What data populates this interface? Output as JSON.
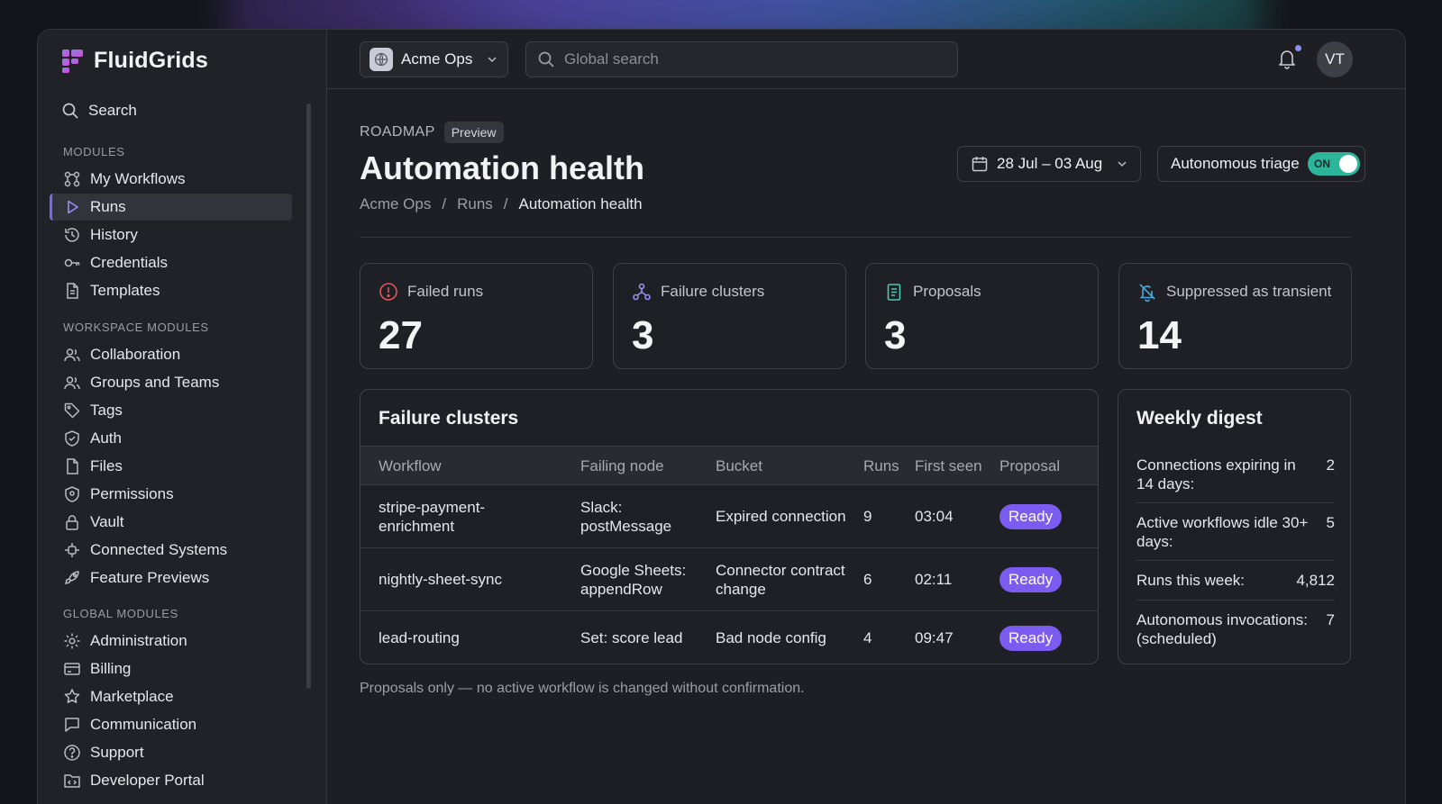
{
  "brand": {
    "name": "FluidGrids"
  },
  "sidebar": {
    "search_label": "Search",
    "sections": {
      "modules": "MODULES",
      "workspace": "WORKSPACE MODULES",
      "global": "GLOBAL MODULES"
    },
    "modules": [
      {
        "label": "My Workflows",
        "icon": "workflow-icon"
      },
      {
        "label": "Runs",
        "icon": "play-icon",
        "active": true
      },
      {
        "label": "History",
        "icon": "history-icon"
      },
      {
        "label": "Credentials",
        "icon": "key-icon"
      },
      {
        "label": "Templates",
        "icon": "document-icon"
      }
    ],
    "workspace": [
      {
        "label": "Collaboration",
        "icon": "users-icon"
      },
      {
        "label": "Groups and Teams",
        "icon": "users-icon"
      },
      {
        "label": "Tags",
        "icon": "tag-icon"
      },
      {
        "label": "Auth",
        "icon": "shield-check-icon"
      },
      {
        "label": "Files",
        "icon": "file-icon"
      },
      {
        "label": "Permissions",
        "icon": "shield-icon"
      },
      {
        "label": "Vault",
        "icon": "lock-icon"
      },
      {
        "label": "Connected Systems",
        "icon": "plug-icon"
      },
      {
        "label": "Feature Previews",
        "icon": "rocket-icon"
      }
    ],
    "global": [
      {
        "label": "Administration",
        "icon": "gear-icon"
      },
      {
        "label": "Billing",
        "icon": "card-icon"
      },
      {
        "label": "Marketplace",
        "icon": "store-icon"
      },
      {
        "label": "Communication",
        "icon": "chat-icon"
      },
      {
        "label": "Support",
        "icon": "help-icon"
      },
      {
        "label": "Developer Portal",
        "icon": "code-icon"
      }
    ]
  },
  "topbar": {
    "org": "Acme Ops",
    "search_placeholder": "Global search",
    "avatar": "VT"
  },
  "header": {
    "kicker": "ROADMAP",
    "badge": "Preview",
    "title": "Automation health",
    "breadcrumb": [
      "Acme Ops",
      "Runs",
      "Automation health"
    ],
    "date_range": "28 Jul – 03 Aug",
    "triage_label": "Autonomous triage",
    "triage_state": "ON"
  },
  "stats": [
    {
      "label": "Failed runs",
      "value": "27",
      "icon": "alert-circle-icon"
    },
    {
      "label": "Failure clusters",
      "value": "3",
      "icon": "cluster-icon"
    },
    {
      "label": "Proposals",
      "value": "3",
      "icon": "clipboard-icon"
    },
    {
      "label": "Suppressed as transient",
      "value": "14",
      "icon": "bell-off-icon"
    }
  ],
  "clusters": {
    "title": "Failure clusters",
    "columns": [
      "Workflow",
      "Failing node",
      "Bucket",
      "Runs",
      "First seen",
      "Proposal"
    ],
    "rows": [
      {
        "workflow": "stripe-payment-enrichment",
        "node": "Slack: postMessage",
        "bucket": "Expired connection",
        "runs": "9",
        "first_seen": "03:04",
        "proposal": "Ready"
      },
      {
        "workflow": "nightly-sheet-sync",
        "node": "Google Sheets: appendRow",
        "bucket": "Connector contract change",
        "runs": "6",
        "first_seen": "02:11",
        "proposal": "Ready"
      },
      {
        "workflow": "lead-routing",
        "node": "Set: score lead",
        "bucket": "Bad node config",
        "runs": "4",
        "first_seen": "09:47",
        "proposal": "Ready"
      }
    ]
  },
  "digest": {
    "title": "Weekly digest",
    "rows": [
      {
        "label": "Connections expiring in 14 days:",
        "value": "2"
      },
      {
        "label": "Active workflows idle 30+ days:",
        "value": "5"
      },
      {
        "label": "Runs this week:",
        "value": "4,812"
      },
      {
        "label": "Autonomous invocations: (scheduled)",
        "value": "7"
      }
    ]
  },
  "footnote": "Proposals only — no active workflow is changed without confirmation.",
  "colors": {
    "accent": "#7a5cf0",
    "toggle_on": "#2bb59a",
    "alert": "#e0565b",
    "bg": "#1e1f24"
  }
}
